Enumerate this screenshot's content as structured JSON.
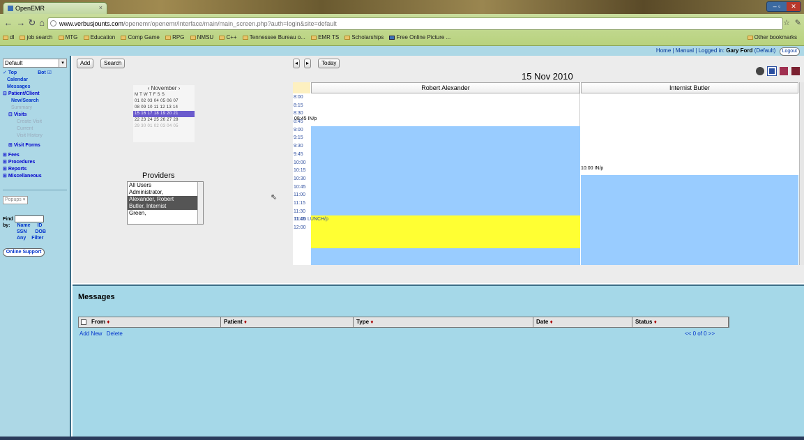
{
  "browser": {
    "tab_title": "OpenEMR",
    "url_host": "www.verbusjounts.com",
    "url_path": "/openemr/openemr/interface/main/main_screen.php?auth=login&site=default",
    "bookmarks": [
      "dl",
      "job search",
      "MTG",
      "Education",
      "Comp Game",
      "RPG",
      "NMSU",
      "C++",
      "Tennessee Bureau o...",
      "EMR TS",
      "Scholarships",
      "Free Online Picture ..."
    ],
    "other_bookmarks": "Other bookmarks"
  },
  "topbar": {
    "home": "Home",
    "manual": "Manual",
    "logged_in_prefix": "Logged in:",
    "user": "Gary Ford",
    "user_suffix": "(Default)",
    "logout": "Logout"
  },
  "leftnav": {
    "default_select": "Default",
    "top_label": "Top",
    "bot_label": "Bot",
    "items": {
      "calendar": "Calendar",
      "messages": "Messages",
      "patient_client": "Patient/Client",
      "new_search": "New/Search",
      "summary": "Summary",
      "visits": "Visits",
      "create_visit": "Create Visit",
      "current": "Current",
      "visit_history": "Visit History",
      "visit_forms": "Visit Forms",
      "fees": "Fees",
      "procedures": "Procedures",
      "reports": "Reports",
      "miscellaneous": "Miscellaneous"
    },
    "popups": "Popups",
    "find_label": "Find",
    "by_label": "by:",
    "find_options": [
      "Name",
      "ID",
      "SSN",
      "DOB",
      "Any",
      "Filter"
    ],
    "online_support": "Online Support"
  },
  "calendar": {
    "add_button": "Add",
    "search_button": "Search",
    "today_button": "Today",
    "date_heading": "15 Nov 2010",
    "mini_month": "November",
    "mini_days_header": "M T W T F S S",
    "mini_rows": [
      "01 02 03 04 05 06 07",
      "08 09 10 11 12 13 14",
      "15 16 17 18 19 20 21",
      "22 23 24 25 26 27 28",
      "29 30 01 02 03 04 05"
    ],
    "providers_title": "Providers",
    "providers": [
      "All Users",
      "Administrator,",
      "Alexander, Robert",
      "Butler, Internist",
      "Green,"
    ],
    "selected_providers": [
      "Alexander, Robert",
      "Butler, Internist"
    ],
    "columns": [
      "Robert Alexander",
      "Internist Butler"
    ],
    "times": [
      "8:00",
      "8:15",
      "8:30",
      "8:45",
      "9:00",
      "9:15",
      "9:30",
      "9:45",
      "10:00",
      "10:15",
      "10:30",
      "10:45",
      "11:00",
      "11:15",
      "11:30",
      "11:45",
      "12:00"
    ],
    "events": {
      "alexander_0845": "08:45 IN/p",
      "alexander_lunch": "11:00 LUNCH/p",
      "butler_1000": "10:00 IN/p"
    },
    "colors": {
      "booked": "#99ccff",
      "lunch": "#ffff33",
      "open": "#ffffff"
    }
  },
  "messages": {
    "title": "Messages",
    "columns": [
      "From",
      "Patient",
      "Type",
      "Date",
      "Status"
    ],
    "add_new": "Add New",
    "delete": "Delete",
    "pager": "<< 0 of 0 >>"
  }
}
